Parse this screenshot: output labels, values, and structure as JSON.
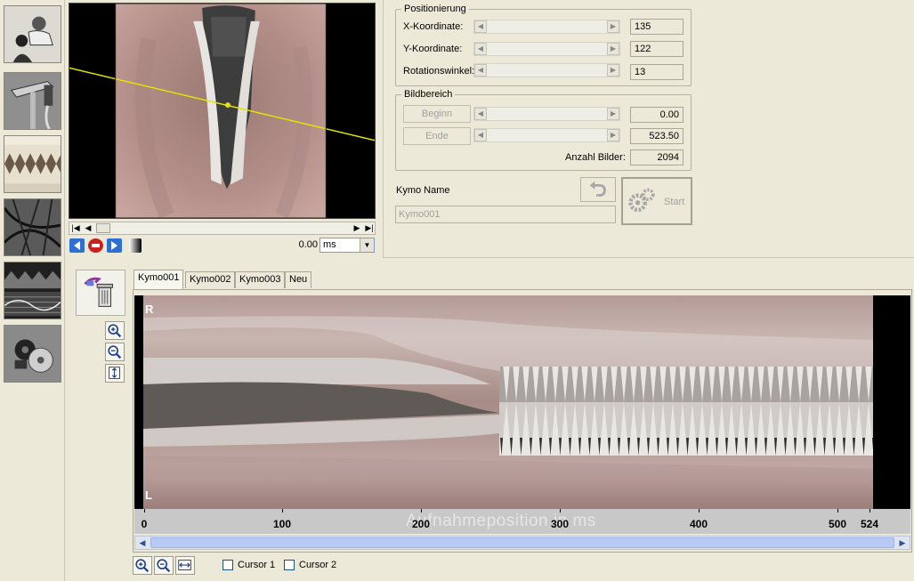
{
  "sidebar": {
    "tools": [
      {
        "name": "patient-icon"
      },
      {
        "name": "endoscope-icon"
      },
      {
        "name": "kymogram-icon"
      },
      {
        "name": "waveform-icon"
      },
      {
        "name": "spectrogram-icon"
      },
      {
        "name": "disc-export-icon"
      }
    ]
  },
  "video": {
    "time_value": "0.00",
    "unit": "ms"
  },
  "positioning": {
    "title": "Positionierung",
    "rows": [
      {
        "label": "X-Koordinate:",
        "value": "135"
      },
      {
        "label": "Y-Koordinate:",
        "value": "122"
      },
      {
        "label": "Rotationswinkel:",
        "value": "13"
      }
    ]
  },
  "image_range": {
    "title": "Bildbereich",
    "begin_label": "Beginn",
    "begin_value": "0.00",
    "end_label": "Ende",
    "end_value": "523.50",
    "count_label": "Anzahl Bilder:",
    "count_value": "2094"
  },
  "kymo_name": {
    "label": "Kymo Name",
    "value": "Kymo001"
  },
  "start_label": "Start",
  "tabs": [
    "Kymo001",
    "Kymo002",
    "Kymo003",
    "Neu"
  ],
  "kymo": {
    "right_label": "R",
    "left_label": "L",
    "axis_title": "Aufnahmeposition in ms",
    "ticks": [
      "0",
      "100",
      "200",
      "300",
      "400",
      "500",
      "524"
    ]
  },
  "cursors": {
    "cursor1": "Cursor 1",
    "cursor2": "Cursor 2"
  }
}
